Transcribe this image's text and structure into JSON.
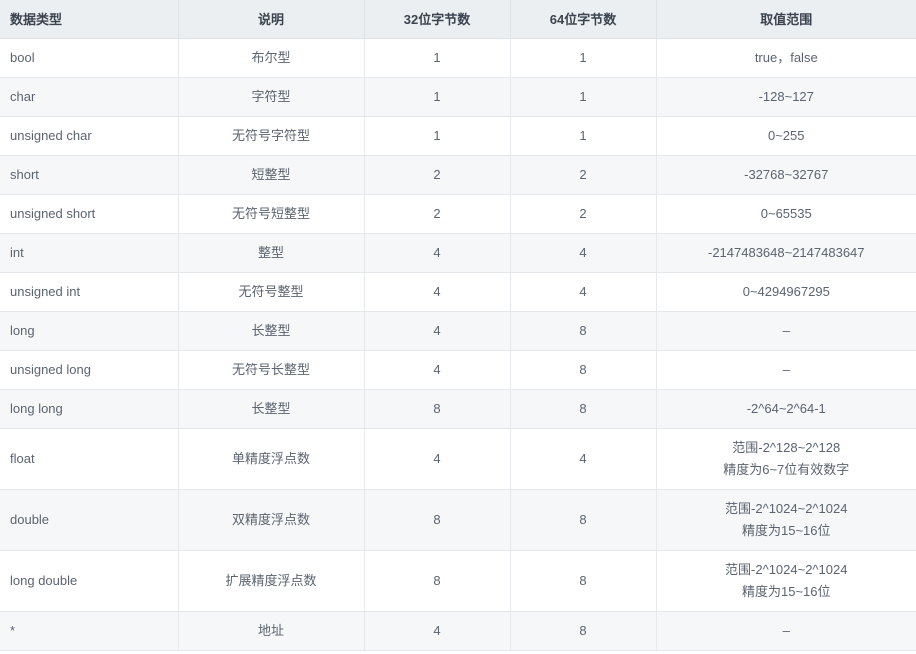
{
  "table": {
    "columns": [
      {
        "key": "type",
        "label": "数据类型",
        "align": "left"
      },
      {
        "key": "desc",
        "label": "说明",
        "align": "center"
      },
      {
        "key": "b32",
        "label": "32位字节数",
        "align": "center"
      },
      {
        "key": "b64",
        "label": "64位字节数",
        "align": "center"
      },
      {
        "key": "range",
        "label": "取值范围",
        "align": "center"
      }
    ],
    "header_bg": "#eceff1",
    "header_text_color": "#3c4450",
    "row_odd_bg": "#f6f7f8",
    "row_even_bg": "#ffffff",
    "border_color": "#e6e9ec",
    "body_text_color": "#5b6470",
    "rows": [
      {
        "type": "bool",
        "desc": "布尔型",
        "b32": "1",
        "b64": "1",
        "range": [
          "true，false"
        ]
      },
      {
        "type": "char",
        "desc": "字符型",
        "b32": "1",
        "b64": "1",
        "range": [
          "-128~127"
        ]
      },
      {
        "type": "unsigned char",
        "desc": "无符号字符型",
        "b32": "1",
        "b64": "1",
        "range": [
          "0~255"
        ]
      },
      {
        "type": "short",
        "desc": "短整型",
        "b32": "2",
        "b64": "2",
        "range": [
          "-32768~32767"
        ]
      },
      {
        "type": "unsigned short",
        "desc": "无符号短整型",
        "b32": "2",
        "b64": "2",
        "range": [
          "0~65535"
        ]
      },
      {
        "type": "int",
        "desc": "整型",
        "b32": "4",
        "b64": "4",
        "range": [
          "-2147483648~2147483647"
        ]
      },
      {
        "type": "unsigned int",
        "desc": "无符号整型",
        "b32": "4",
        "b64": "4",
        "range": [
          "0~4294967295"
        ]
      },
      {
        "type": "long",
        "desc": "长整型",
        "b32": "4",
        "b64": "8",
        "range": [
          "–"
        ]
      },
      {
        "type": "unsigned long",
        "desc": "无符号长整型",
        "b32": "4",
        "b64": "8",
        "range": [
          "–"
        ]
      },
      {
        "type": "long long",
        "desc": "长整型",
        "b32": "8",
        "b64": "8",
        "range": [
          "-2^64~2^64-1"
        ]
      },
      {
        "type": "float",
        "desc": "单精度浮点数",
        "b32": "4",
        "b64": "4",
        "range": [
          "范围-2^128~2^128",
          "精度为6~7位有效数字"
        ]
      },
      {
        "type": "double",
        "desc": "双精度浮点数",
        "b32": "8",
        "b64": "8",
        "range": [
          "范围-2^1024~2^1024",
          "精度为15~16位"
        ]
      },
      {
        "type": "long double",
        "desc": "扩展精度浮点数",
        "b32": "8",
        "b64": "8",
        "range": [
          "范围-2^1024~2^1024",
          "精度为15~16位"
        ]
      },
      {
        "type": "*",
        "desc": "地址",
        "b32": "4",
        "b64": "8",
        "range": [
          "–"
        ]
      }
    ]
  }
}
